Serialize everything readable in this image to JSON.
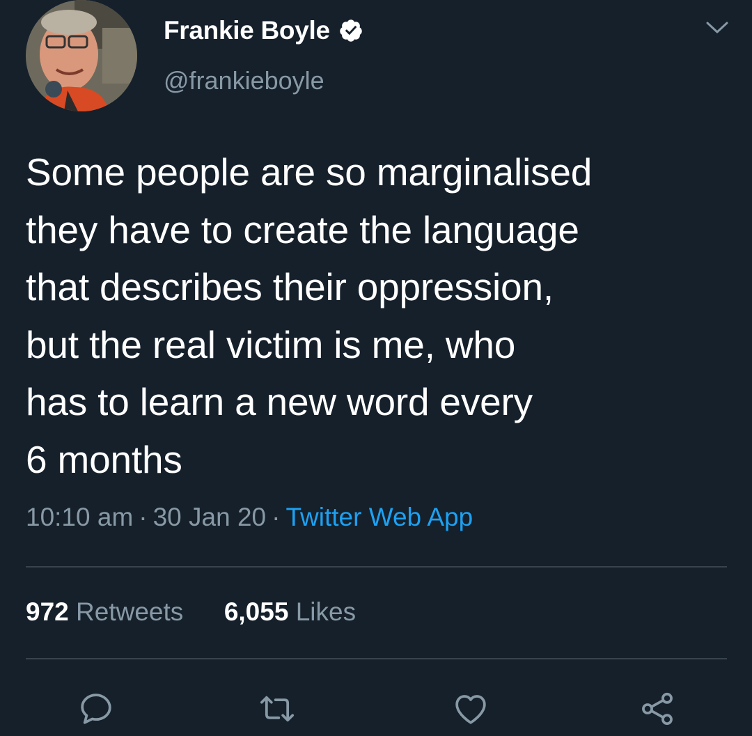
{
  "author": {
    "display_name": "Frankie Boyle",
    "handle": "@frankieboyle",
    "verified": true
  },
  "tweet": {
    "text": "Some people are so marginalised\nthey have to create the language\nthat describes their oppression,\nbut the real victim is me, who\nhas to learn a new word every\n6 months",
    "time": "10:10 am",
    "date": "30 Jan 20",
    "separator": "·",
    "source": "Twitter Web App"
  },
  "stats": {
    "retweets_count": "972",
    "retweets_label": "Retweets",
    "likes_count": "6,055",
    "likes_label": "Likes"
  },
  "icons": {
    "menu": "chevron-down-icon",
    "reply": "reply-icon",
    "retweet": "retweet-icon",
    "like": "heart-icon",
    "share": "share-icon",
    "verified": "verified-badge-icon"
  },
  "colors": {
    "background": "#15202b",
    "text_primary": "#ffffff",
    "text_secondary": "#8899a6",
    "link": "#1da1f2",
    "divider": "#38444d"
  }
}
